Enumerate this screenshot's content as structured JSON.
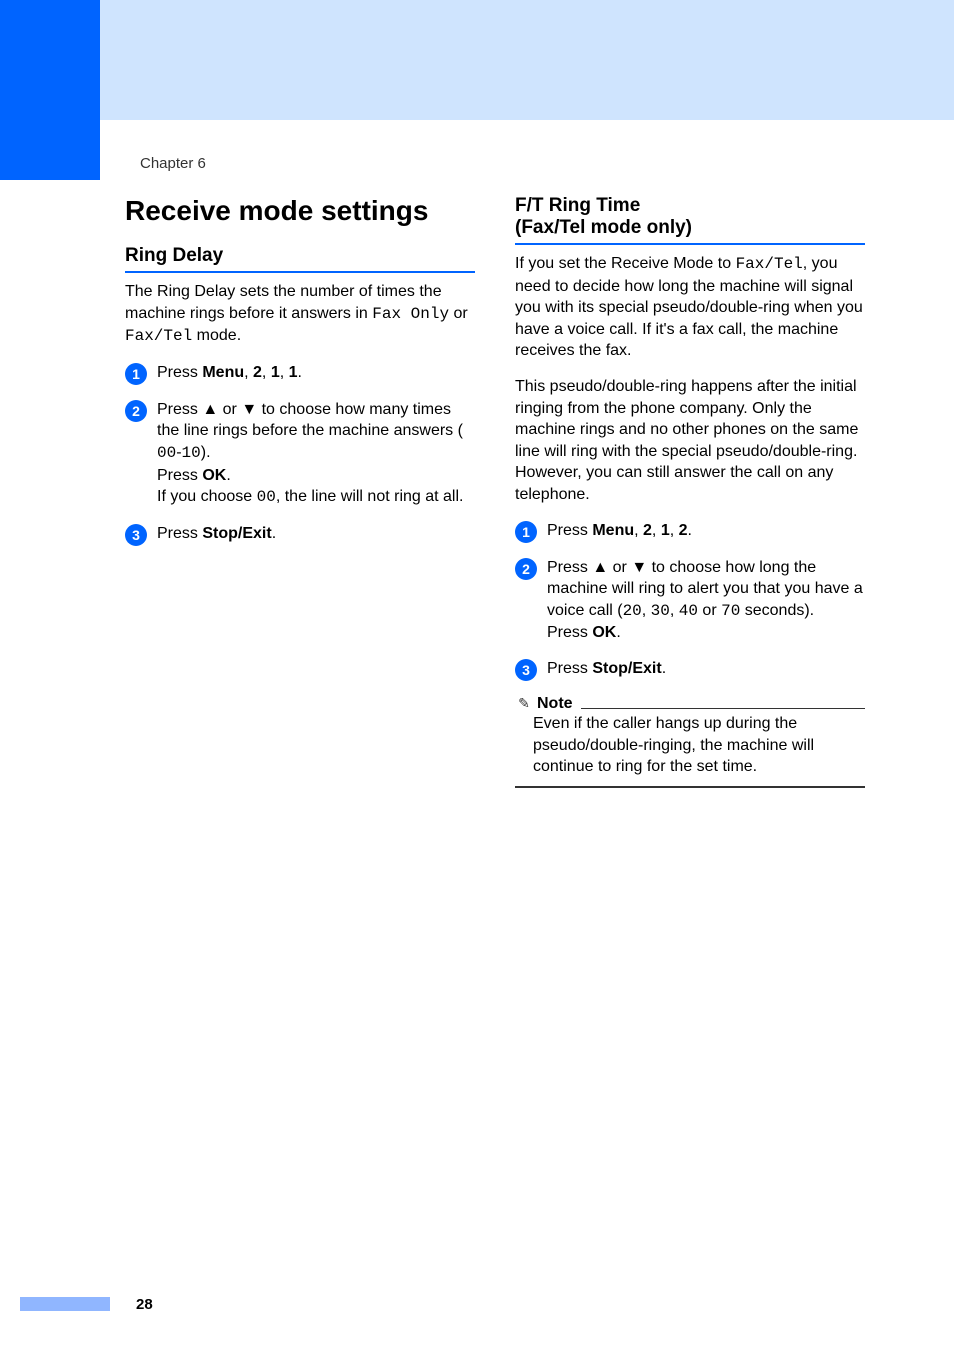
{
  "chapter": "Chapter 6",
  "left": {
    "title": "Receive mode settings",
    "h2": "Ring Delay",
    "intro_parts": [
      "The Ring Delay sets the number of times the machine rings before it answers in ",
      "Fax Only",
      " or ",
      "Fax/Tel",
      " mode."
    ],
    "steps": {
      "s1": {
        "pre": "Press ",
        "b": "Menu",
        "post": ", ",
        "b2": "2",
        "c": ", ",
        "b3": "1",
        "c2": ", ",
        "b4": "1",
        "end": "."
      },
      "s2": {
        "line1_pre": "Press ",
        "up": "▲",
        "mid": " or ",
        "down": "▼",
        "line1_post": " to choose how many times the line rings before the machine answers ( ",
        "range": "00",
        "dash": "-",
        "range2": "10",
        "close": ").",
        "press": "Press ",
        "ok": "OK",
        "dot": ".",
        "ifpre": "If you choose ",
        "zero": "00",
        "ifpost": ", the line will not ring at all."
      },
      "s3": {
        "pre": "Press ",
        "b": "Stop/Exit",
        "post": "."
      }
    }
  },
  "right": {
    "h2a": "F/T Ring Time",
    "h2b": "(Fax/Tel mode only)",
    "p1_pre": "If you set the Receive Mode to ",
    "p1_code": "Fax/Tel",
    "p1_post": ", you need to decide how long the machine will signal you with its special pseudo/double-ring when you have a voice call. If it's a fax call, the machine receives the fax.",
    "p2": "This pseudo/double-ring happens after the initial ringing from the phone company. Only the machine rings and no other phones on the same line will ring with the special pseudo/double-ring. However, you can still answer the call on any telephone.",
    "steps": {
      "s1": {
        "pre": "Press ",
        "b": "Menu",
        "post": ", ",
        "b2": "2",
        "c": ", ",
        "b3": "1",
        "c2": ", ",
        "b4": "2",
        "end": "."
      },
      "s2": {
        "line1_pre": "Press ",
        "up": "▲",
        "mid": " or ",
        "down": "▼",
        "line1_post": " to choose how long the machine will ring to alert you that you have a voice call (",
        "o1": "20",
        "cm1": ", ",
        "o2": "30",
        "cm2": ", ",
        "o3": "40",
        "or": " or ",
        "o4": "70",
        "sec": " seconds).",
        "press": "Press ",
        "ok": "OK",
        "dot": "."
      },
      "s3": {
        "pre": "Press ",
        "b": "Stop/Exit",
        "post": "."
      }
    },
    "note_label": "Note",
    "note_body": "Even if the caller hangs up during the pseudo/double-ringing, the machine will continue to ring for the set time."
  },
  "page": "28"
}
